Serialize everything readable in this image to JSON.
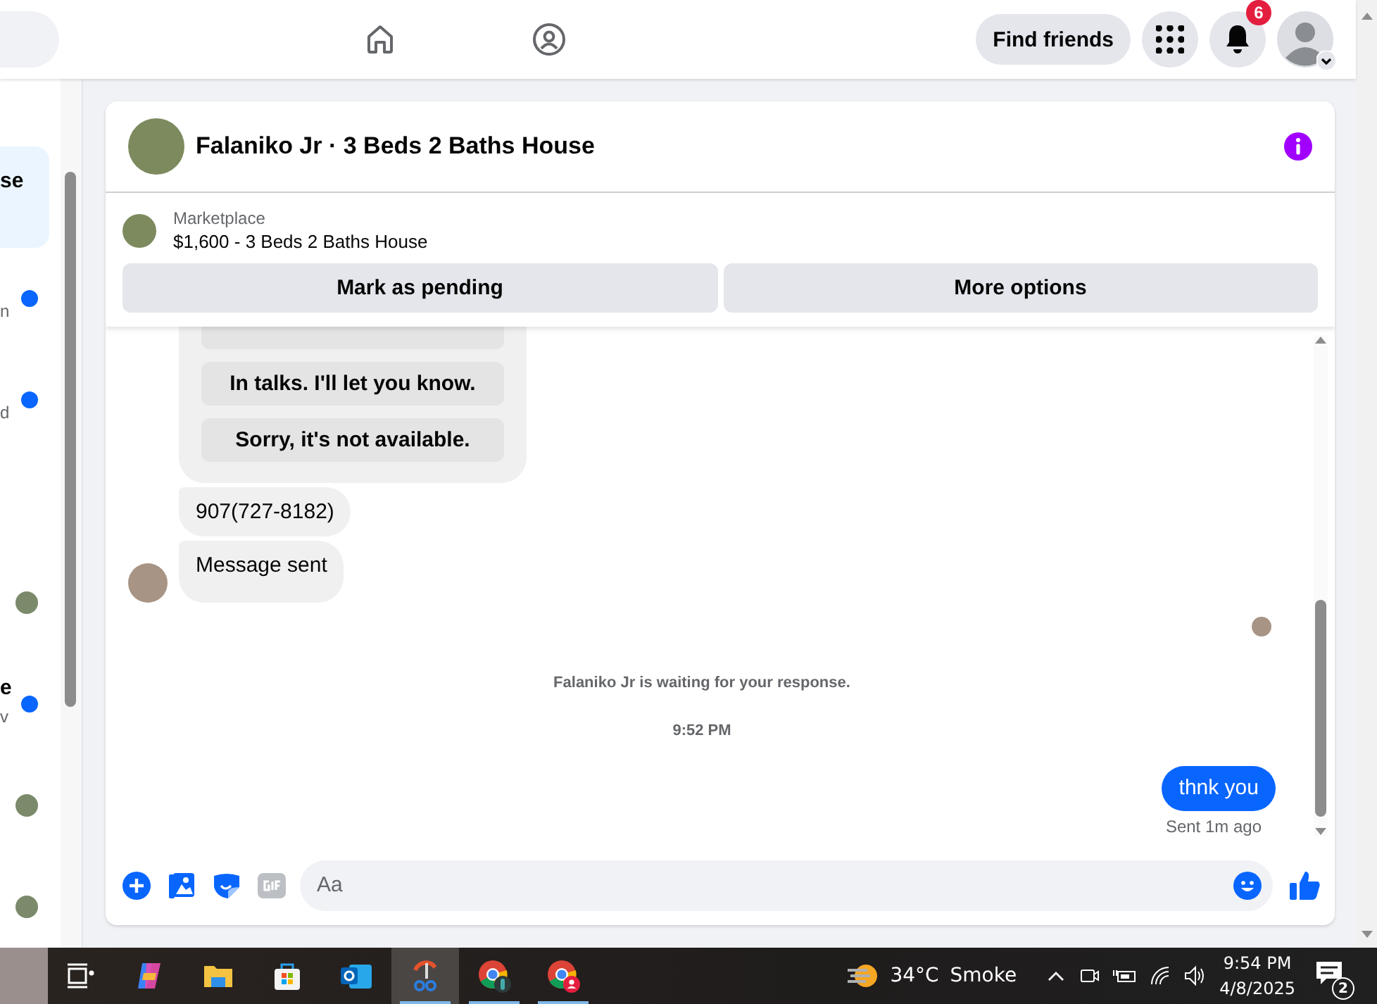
{
  "nav": {
    "find_friends_button": "Find friends",
    "notification_count": "6"
  },
  "sidebar": {
    "items": [
      {
        "kind": "preview",
        "title": "se",
        "selected": true,
        "unread": false
      },
      {
        "kind": "preview",
        "subtitle": "n",
        "selected": false,
        "unread": true
      },
      {
        "kind": "preview",
        "subtitle": "d",
        "selected": false,
        "unread": true
      },
      {
        "kind": "avatar",
        "selected": false,
        "unread": false
      },
      {
        "kind": "preview",
        "title": "e",
        "subtitle": "v",
        "selected": false,
        "unread": true
      },
      {
        "kind": "avatar",
        "selected": false,
        "unread": false
      },
      {
        "kind": "avatar",
        "selected": false,
        "unread": false
      }
    ]
  },
  "conversation": {
    "title": "Falaniko Jr · 3 Beds 2 Baths House",
    "listing": {
      "source": "Marketplace",
      "summary": "$1,600 - 3 Beds 2 Baths House"
    },
    "actions": [
      "Mark as pending",
      "More options"
    ],
    "messages": [
      {
        "kind": "quick_replies",
        "replies": [
          "In talks. I'll let you know.",
          "Sorry, it's not available."
        ]
      },
      {
        "kind": "incoming",
        "text": "907(727-8182)",
        "avatar": false
      },
      {
        "kind": "incoming",
        "text": "Message sent",
        "avatar": true
      },
      {
        "kind": "read_receipt"
      },
      {
        "kind": "notice",
        "text": "Falaniko Jr is waiting for your response."
      },
      {
        "kind": "timestamp",
        "text": "9:52 PM"
      },
      {
        "kind": "outgoing",
        "text": "thnk you",
        "status": "Sent 1m ago"
      }
    ],
    "composer": {
      "placeholder": "Aa"
    }
  },
  "taskbar": {
    "apps": [
      {
        "kind": "task_view",
        "running": false,
        "selected": false
      },
      {
        "kind": "copilot",
        "running": false,
        "selected": false
      },
      {
        "kind": "file_explorer",
        "running": false,
        "selected": false
      },
      {
        "kind": "store",
        "running": false,
        "selected": false
      },
      {
        "kind": "mail",
        "running": false,
        "selected": false
      },
      {
        "kind": "scissors",
        "running": true,
        "selected": true
      },
      {
        "kind": "browser",
        "running": true,
        "selected": false
      },
      {
        "kind": "browser_profile",
        "running": true,
        "selected": false
      }
    ],
    "weather": {
      "temperature": "34°C",
      "condition": "Smoke"
    },
    "clock": {
      "time": "9:54 PM",
      "date": "4/8/2025"
    },
    "notification_count": "2"
  }
}
